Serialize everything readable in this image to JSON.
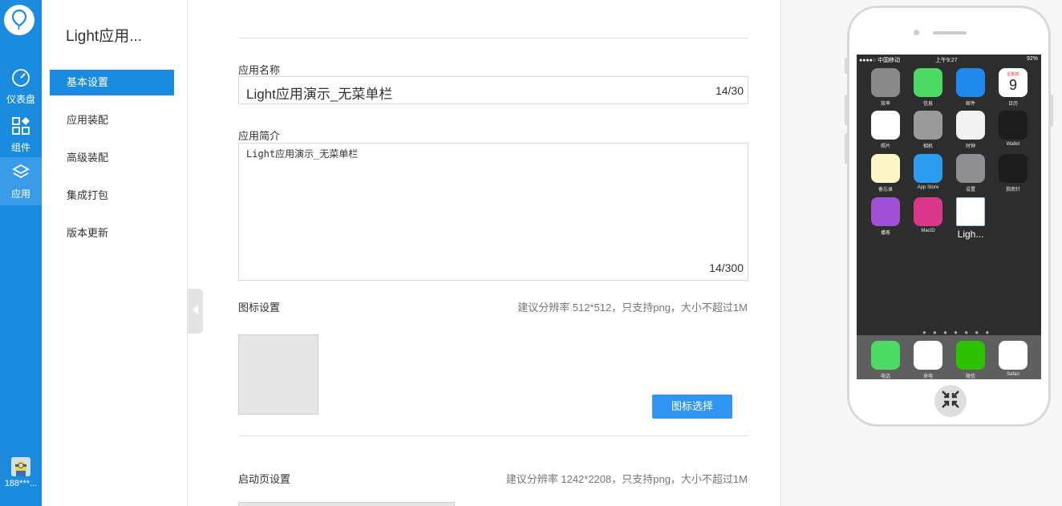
{
  "rail": {
    "items": [
      {
        "label": "仪表盘",
        "icon": "dashboard-icon"
      },
      {
        "label": "组件",
        "icon": "components-icon"
      },
      {
        "label": "应用",
        "icon": "layers-icon"
      }
    ],
    "user": "188***..."
  },
  "subnav": {
    "title": "Light应用...",
    "items": [
      "基本设置",
      "应用装配",
      "高级装配",
      "集成打包",
      "版本更新"
    ]
  },
  "form": {
    "name_label": "应用名称",
    "name_value": "Light应用演示_无菜单栏",
    "name_count": "14/30",
    "intro_label": "应用简介",
    "intro_value": "Light应用演示_无菜单栏",
    "intro_count": "14/300",
    "icon_label": "图标设置",
    "icon_hint": "建议分辨率 512*512，只支持png，大小不超过1M",
    "icon_button": "图标选择",
    "splash_label": "启动页设置",
    "splash_hint": "建议分辨率 1242*2208，只支持png，大小不超过1M"
  },
  "phone": {
    "status_left": "●●●●○ 中国移动 ",
    "status_time": "上午9:27",
    "status_right": "92%",
    "apps": [
      {
        "name": "效率",
        "color": "#8a8a8a"
      },
      {
        "name": "信息",
        "color": "#4cd964"
      },
      {
        "name": "邮件",
        "color": "#1e88ec"
      },
      {
        "name": "日历",
        "color": "#ffffff"
      },
      {
        "name": "照片",
        "color": "#ffffff"
      },
      {
        "name": "相机",
        "color": "#9a9a9a"
      },
      {
        "name": "时钟",
        "color": "#f2f2f2"
      },
      {
        "name": "Wallet",
        "color": "#1c1c1c"
      },
      {
        "name": "备忘录",
        "color": "#fff6c8"
      },
      {
        "name": "App Store",
        "color": "#2b9cf0"
      },
      {
        "name": "设置",
        "color": "#8e8e93"
      },
      {
        "name": "指南针",
        "color": "#1c1c1c"
      },
      {
        "name": "播客",
        "color": "#a14fd6"
      },
      {
        "name": "MacID",
        "color": "#d9388a"
      },
      {
        "name": "Ligh...",
        "color": "#ffffff"
      }
    ],
    "dock": [
      {
        "name": "电话",
        "color": "#4cd964"
      },
      {
        "name": "来电",
        "color": "#ffffff"
      },
      {
        "name": "微信",
        "color": "#2dc100"
      },
      {
        "name": "Safari",
        "color": "#ffffff"
      }
    ],
    "calendar_day": "9",
    "calendar_week": "星期四"
  }
}
